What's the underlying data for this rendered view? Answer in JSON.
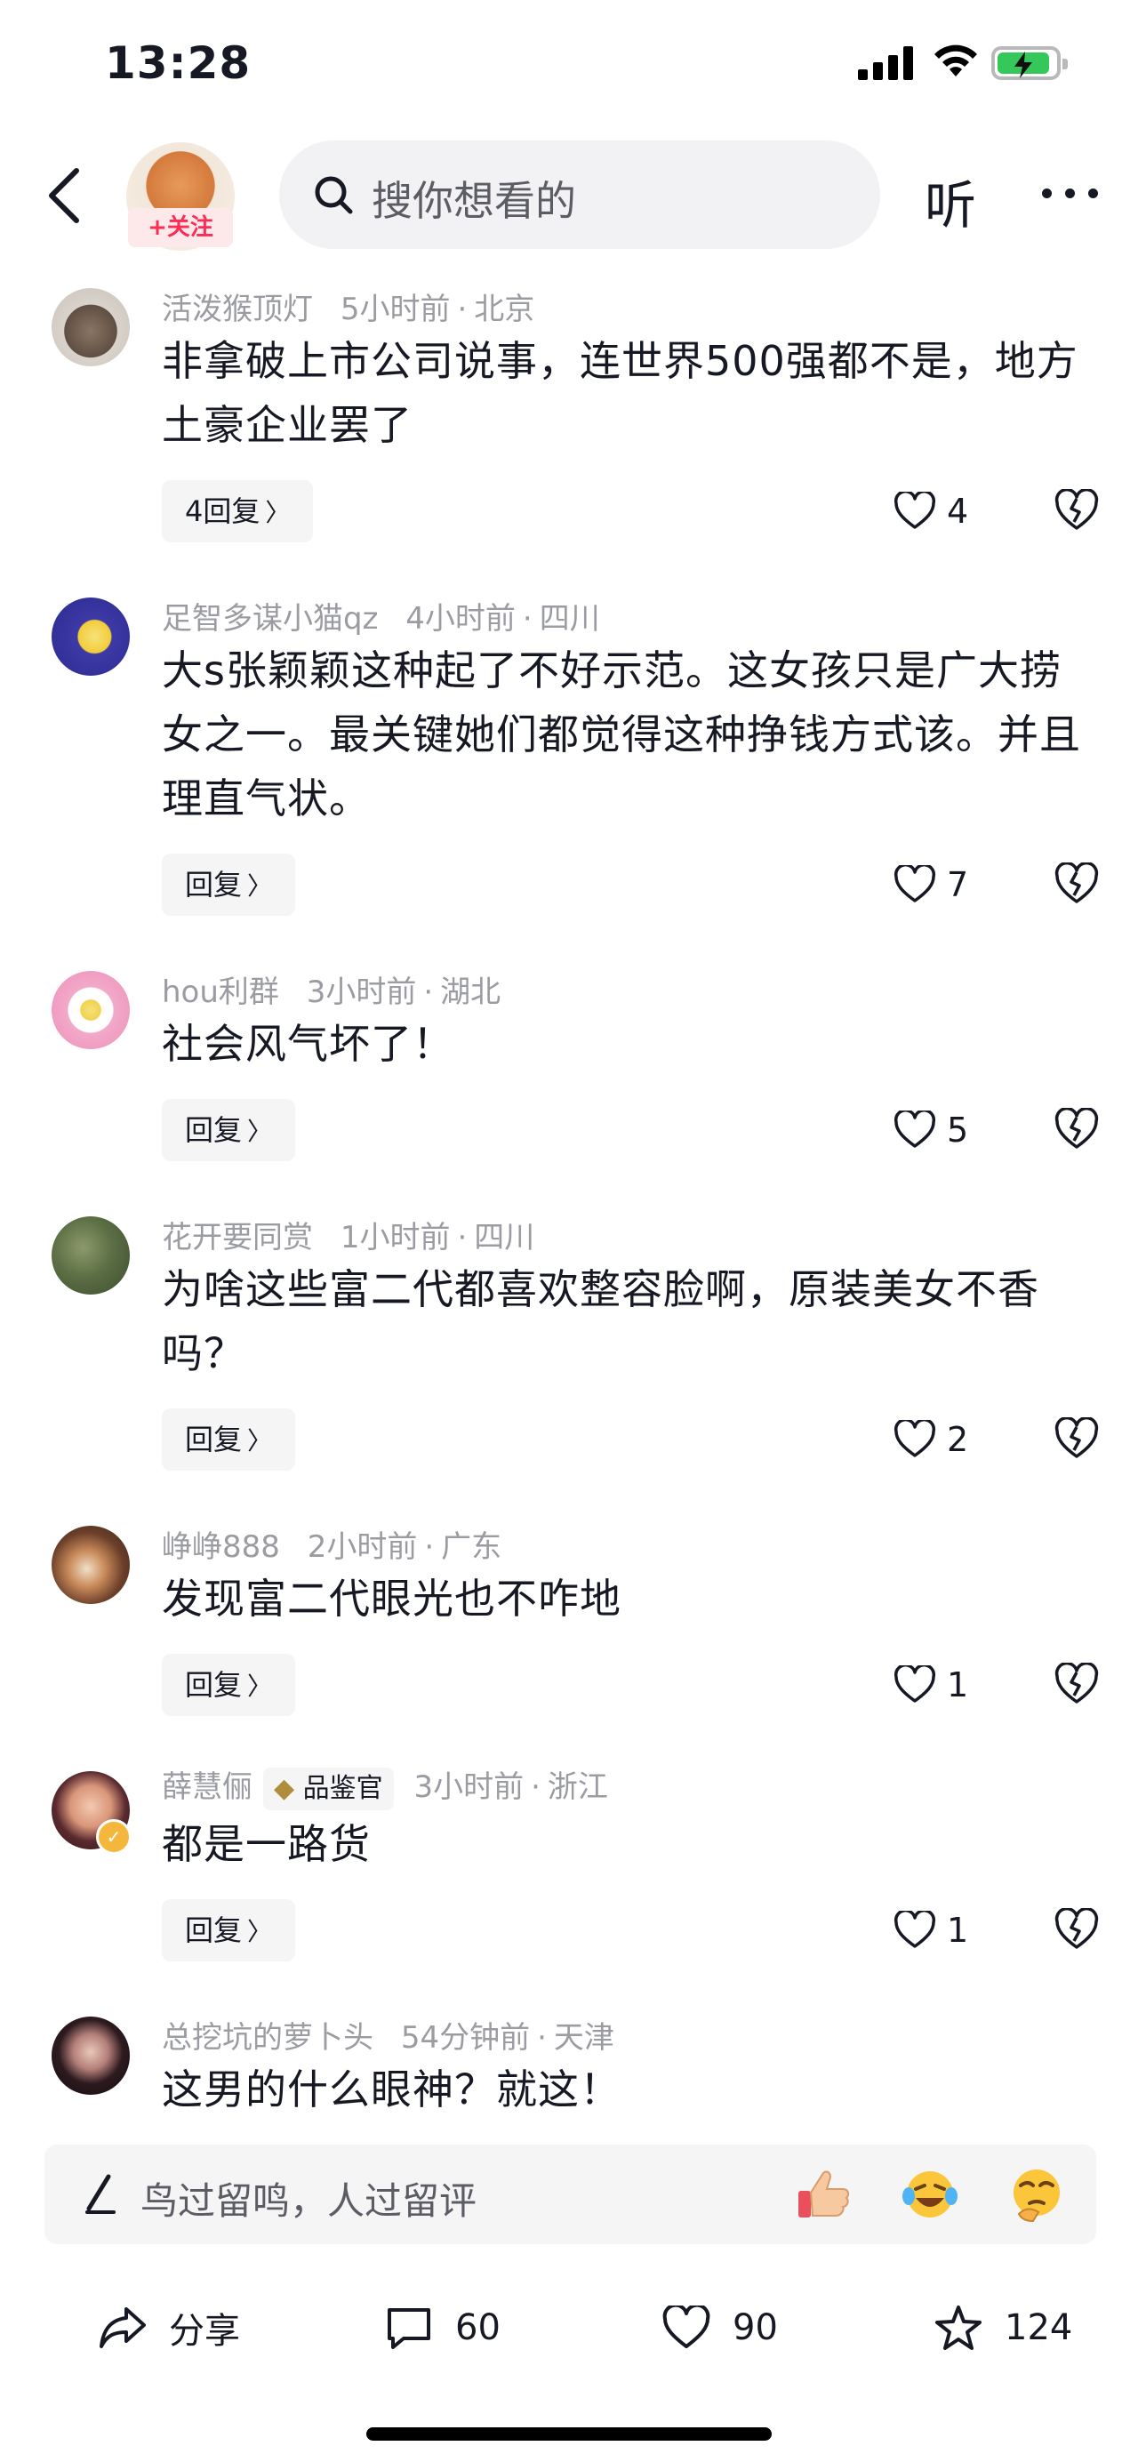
{
  "status_bar": {
    "time": "13:28"
  },
  "nav": {
    "follow_label": "+关注",
    "search_placeholder": "搜你想看的",
    "listen_label": "听"
  },
  "comments": [
    {
      "user": "活泼猴顶灯",
      "time": "5小时前",
      "location": "北京",
      "text": "非拿破上市公司说事，连世界500强都不是，地方土豪企业罢了",
      "reply": "4回复",
      "likes": "4"
    },
    {
      "user": "足智多谋小猫qz",
      "time": "4小时前",
      "location": "四川",
      "text": "大s张颖颖这种起了不好示范。这女孩只是广大捞女之一。最关键她们都觉得这种挣钱方式该。并且理直气状。",
      "reply": "回复",
      "likes": "7"
    },
    {
      "user": "hou利群",
      "time": "3小时前",
      "location": "湖北",
      "text": "社会风气坏了！",
      "reply": "回复",
      "likes": "5"
    },
    {
      "user": "花开要同赏",
      "time": "1小时前",
      "location": "四川",
      "text": "为啥这些富二代都喜欢整容脸啊，原装美女不香吗？",
      "reply": "回复",
      "likes": "2"
    },
    {
      "user": "峥峥888",
      "time": "2小时前",
      "location": "广东",
      "text": "发现富二代眼光也不咋地",
      "reply": "回复",
      "likes": "1"
    },
    {
      "user": "薛慧俪",
      "badge": "品鉴官",
      "time": "3小时前",
      "location": "浙江",
      "text": "都是一路货",
      "reply": "回复",
      "likes": "1"
    },
    {
      "user": "总挖坑的萝卜头",
      "time": "54分钟前",
      "location": "天津",
      "text": "这男的什么眼神？就这！"
    }
  ],
  "input": {
    "placeholder": "鸟过留鸣，人过留评"
  },
  "actions": {
    "share_label": "分享",
    "comments_count": "60",
    "likes_count": "90",
    "favorites_count": "124"
  },
  "colors": {
    "accent": "#fe2c55",
    "text": "#161823",
    "meta": "#9b9ca2",
    "button_bg": "#f5f5f6"
  },
  "icons": [
    "back-arrow-icon",
    "search-icon",
    "more-icon",
    "heart-icon",
    "broken-heart-icon",
    "pen-icon",
    "thumbs-up-emoji",
    "laugh-cry-emoji",
    "thinking-emoji",
    "share-icon",
    "comment-icon",
    "star-icon"
  ]
}
